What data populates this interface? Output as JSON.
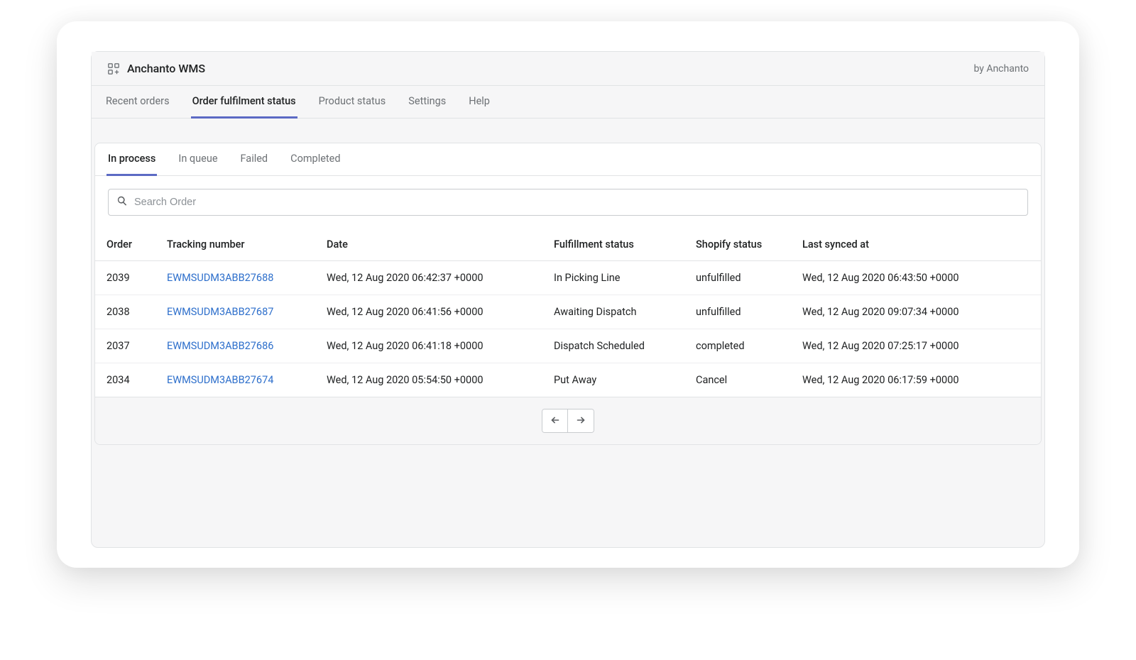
{
  "header": {
    "app_title": "Anchanto WMS",
    "by_text": "by Anchanto"
  },
  "main_tabs": [
    {
      "label": "Recent orders",
      "active": false
    },
    {
      "label": "Order fulfilment status",
      "active": true
    },
    {
      "label": "Product status",
      "active": false
    },
    {
      "label": "Settings",
      "active": false
    },
    {
      "label": "Help",
      "active": false
    }
  ],
  "sub_tabs": [
    {
      "label": "In process",
      "active": true
    },
    {
      "label": "In queue",
      "active": false
    },
    {
      "label": "Failed",
      "active": false
    },
    {
      "label": "Completed",
      "active": false
    }
  ],
  "search": {
    "placeholder": "Search Order",
    "value": ""
  },
  "table": {
    "columns": {
      "order": "Order",
      "tracking": "Tracking number",
      "date": "Date",
      "fulfillment_status": "Fulfillment status",
      "shopify_status": "Shopify status",
      "last_synced": "Last synced at"
    },
    "rows": [
      {
        "order": "2039",
        "tracking": "EWMSUDM3ABB27688",
        "date": "Wed, 12 Aug 2020 06:42:37 +0000",
        "fulfillment_status": "In Picking Line",
        "shopify_status": "unfulfilled",
        "last_synced": "Wed, 12 Aug 2020 06:43:50 +0000"
      },
      {
        "order": "2038",
        "tracking": "EWMSUDM3ABB27687",
        "date": "Wed, 12 Aug 2020 06:41:56 +0000",
        "fulfillment_status": "Awaiting Dispatch",
        "shopify_status": "unfulfilled",
        "last_synced": "Wed, 12 Aug 2020 09:07:34 +0000"
      },
      {
        "order": "2037",
        "tracking": "EWMSUDM3ABB27686",
        "date": "Wed, 12 Aug 2020 06:41:18 +0000",
        "fulfillment_status": "Dispatch Scheduled",
        "shopify_status": "completed",
        "last_synced": "Wed, 12 Aug 2020 07:25:17 +0000"
      },
      {
        "order": "2034",
        "tracking": "EWMSUDM3ABB27674",
        "date": "Wed, 12 Aug 2020 05:54:50 +0000",
        "fulfillment_status": "Put Away",
        "shopify_status": "Cancel",
        "last_synced": "Wed, 12 Aug 2020 06:17:59 +0000"
      }
    ]
  }
}
